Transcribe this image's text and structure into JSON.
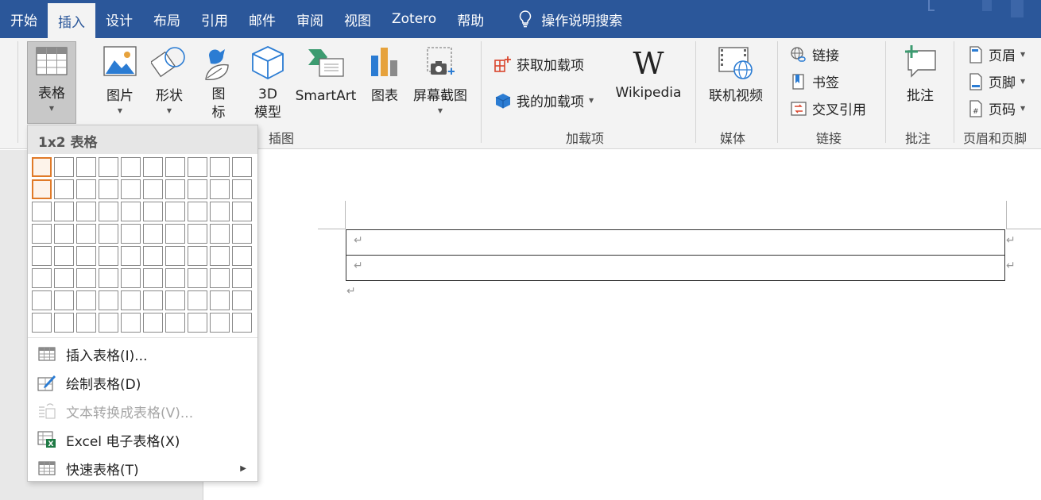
{
  "tabs": [
    "开始",
    "插入",
    "设计",
    "布局",
    "引用",
    "邮件",
    "审阅",
    "视图",
    "Zotero",
    "帮助"
  ],
  "active_tab": "插入",
  "search_label": "操作说明搜索",
  "ribbon": {
    "table_btn": "表格",
    "picture_btn": "图片",
    "shapes_btn": "形状",
    "icons_btn_1": "图",
    "icons_btn_2": "标",
    "model3d_btn_1": "3D",
    "model3d_btn_2": "模型",
    "smartart_btn": "SmartArt",
    "chart_btn": "图表",
    "screenshot_btn": "屏幕截图",
    "illustrations_group": "插图",
    "get_addins": "获取加载项",
    "my_addins": "我的加载项",
    "wikipedia_btn": "Wikipedia",
    "addins_group": "加载项",
    "online_video": "联机视频",
    "media_group": "媒体",
    "link_btn": "链接",
    "bookmark_btn": "书签",
    "crossref_btn": "交叉引用",
    "links_group": "链接",
    "comment_btn": "批注",
    "comments_group": "批注",
    "header_btn": "页眉",
    "footer_btn": "页脚",
    "pagenum_btn": "页码",
    "headerfooter_group": "页眉和页脚"
  },
  "dropdown": {
    "header": "1x2 表格",
    "grid_cols": 10,
    "grid_rows": 8,
    "selected_cols": 1,
    "selected_rows": 2,
    "items": [
      {
        "label": "插入表格(I)...",
        "enabled": true
      },
      {
        "label": "绘制表格(D)",
        "enabled": true
      },
      {
        "label": "文本转换成表格(V)...",
        "enabled": false
      },
      {
        "label": "Excel 电子表格(X)",
        "enabled": true
      },
      {
        "label": "快速表格(T)",
        "enabled": true
      }
    ]
  },
  "document": {
    "paragraph_mark": "↵"
  },
  "colors": {
    "accent": "#2b579a",
    "ribbon_bg": "#f3f3f3",
    "selection": "#e07a28"
  }
}
